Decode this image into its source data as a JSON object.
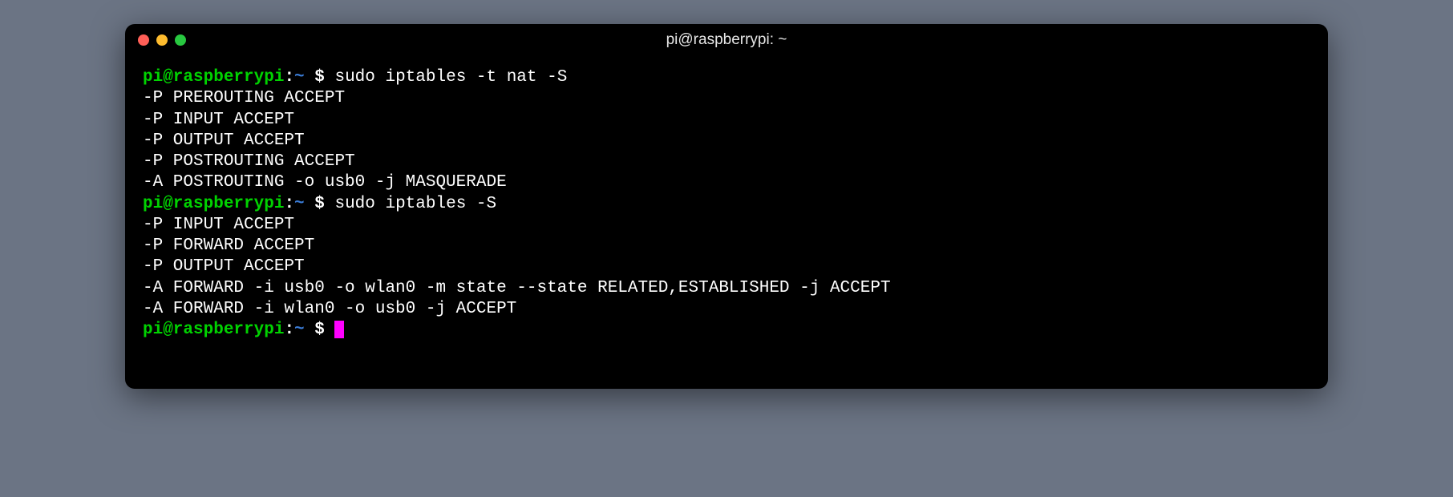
{
  "window": {
    "title": "pi@raspberrypi: ~"
  },
  "prompt": {
    "user_host": "pi@raspberrypi",
    "colon": ":",
    "path": "~",
    "dollar": " $ "
  },
  "lines": [
    {
      "type": "prompt",
      "command": "sudo iptables -t nat -S"
    },
    {
      "type": "output",
      "text": "-P PREROUTING ACCEPT"
    },
    {
      "type": "output",
      "text": "-P INPUT ACCEPT"
    },
    {
      "type": "output",
      "text": "-P OUTPUT ACCEPT"
    },
    {
      "type": "output",
      "text": "-P POSTROUTING ACCEPT"
    },
    {
      "type": "output",
      "text": "-A POSTROUTING -o usb0 -j MASQUERADE"
    },
    {
      "type": "prompt",
      "command": "sudo iptables -S"
    },
    {
      "type": "output",
      "text": "-P INPUT ACCEPT"
    },
    {
      "type": "output",
      "text": "-P FORWARD ACCEPT"
    },
    {
      "type": "output",
      "text": "-P OUTPUT ACCEPT"
    },
    {
      "type": "output",
      "text": "-A FORWARD -i usb0 -o wlan0 -m state --state RELATED,ESTABLISHED -j ACCEPT"
    },
    {
      "type": "output",
      "text": "-A FORWARD -i wlan0 -o usb0 -j ACCEPT"
    },
    {
      "type": "prompt",
      "command": "",
      "cursor": true
    }
  ],
  "colors": {
    "prompt_user": "#00d200",
    "prompt_path": "#3a7bd5",
    "cursor": "#ff00ff",
    "traffic_close": "#ff5f57",
    "traffic_min": "#febc2e",
    "traffic_max": "#28c840"
  }
}
